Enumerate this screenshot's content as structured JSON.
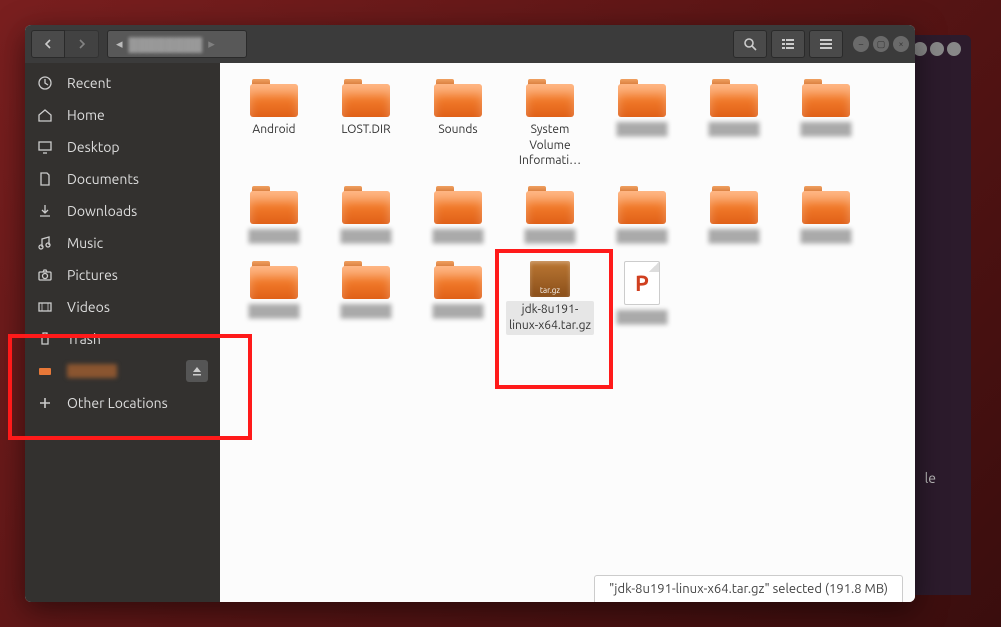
{
  "sidebar": {
    "items": [
      {
        "icon": "clock",
        "label": "Recent"
      },
      {
        "icon": "home",
        "label": "Home"
      },
      {
        "icon": "desktop",
        "label": "Desktop"
      },
      {
        "icon": "doc",
        "label": "Documents"
      },
      {
        "icon": "download",
        "label": "Downloads"
      },
      {
        "icon": "music",
        "label": "Music"
      },
      {
        "icon": "camera",
        "label": "Pictures"
      },
      {
        "icon": "video",
        "label": "Videos"
      },
      {
        "icon": "trash",
        "label": "Trash"
      },
      {
        "icon": "drive",
        "label": "",
        "blurred": true,
        "eject": true
      },
      {
        "icon": "plus",
        "label": "Other Locations"
      }
    ]
  },
  "files": {
    "row1": [
      {
        "type": "folder",
        "label": "Android"
      },
      {
        "type": "folder",
        "label": "LOST.DIR"
      },
      {
        "type": "folder",
        "label": "Sounds"
      },
      {
        "type": "folder",
        "label": "System Volume Informati…"
      },
      {
        "type": "folder",
        "label": "",
        "blurred": true
      },
      {
        "type": "folder",
        "label": "",
        "blurred": true
      },
      {
        "type": "folder",
        "label": "",
        "blurred": true
      }
    ],
    "row2": [
      {
        "type": "folder",
        "label": "",
        "blurred": true
      },
      {
        "type": "folder",
        "label": "",
        "blurred": true
      },
      {
        "type": "folder",
        "label": "",
        "blurred": true
      },
      {
        "type": "folder",
        "label": "",
        "blurred": true
      },
      {
        "type": "folder",
        "label": "",
        "blurred": true
      },
      {
        "type": "folder",
        "label": "",
        "blurred": true
      },
      {
        "type": "folder",
        "label": "",
        "blurred": true
      }
    ],
    "row3": [
      {
        "type": "folder",
        "label": "",
        "blurred": true
      },
      {
        "type": "folder",
        "label": "",
        "blurred": true
      },
      {
        "type": "folder",
        "label": "",
        "blurred": true
      },
      {
        "type": "tar",
        "label": "jdk-8u191-linux-x64.tar.gz",
        "selected": true,
        "ext": "tar.gz"
      },
      {
        "type": "ppt",
        "label": "",
        "blurred": true,
        "letter": "P"
      }
    ]
  },
  "status": "\"jdk-8u191-linux-x64.tar.gz\" selected  (191.8 MB)",
  "bg_text": "le"
}
